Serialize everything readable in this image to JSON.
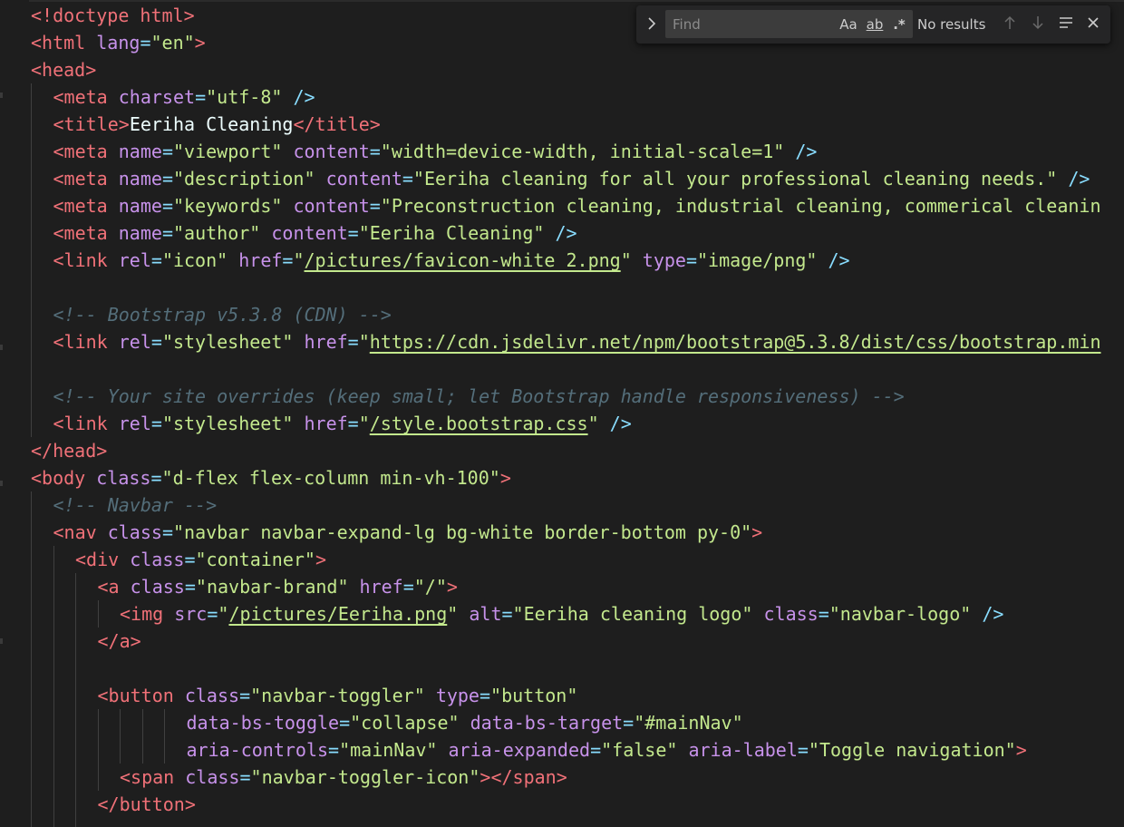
{
  "find_widget": {
    "placeholder": "Find",
    "toggle_icon": "chevron-right-icon",
    "match_case_label": "Aa",
    "whole_word_label": "ab",
    "regex_label": ".*",
    "status": "No results"
  },
  "code_lines": [
    {
      "indent": 0,
      "tokens": [
        {
          "t": "<!doctype html>",
          "c": "bracket"
        }
      ]
    },
    {
      "indent": 0,
      "tokens": [
        {
          "t": "<",
          "c": "bracket"
        },
        {
          "t": "html",
          "c": "tag"
        },
        {
          "t": " ",
          "c": "txt"
        },
        {
          "t": "lang",
          "c": "attr"
        },
        {
          "t": "=",
          "c": "eq"
        },
        {
          "t": "\"en\"",
          "c": "str"
        },
        {
          "t": ">",
          "c": "bracket"
        }
      ]
    },
    {
      "indent": 0,
      "tokens": [
        {
          "t": "<",
          "c": "bracket"
        },
        {
          "t": "head",
          "c": "tag"
        },
        {
          "t": ">",
          "c": "bracket"
        }
      ]
    },
    {
      "indent": 1,
      "tokens": [
        {
          "t": "<",
          "c": "bracket"
        },
        {
          "t": "meta",
          "c": "tag"
        },
        {
          "t": " ",
          "c": "txt"
        },
        {
          "t": "charset",
          "c": "attr"
        },
        {
          "t": "=",
          "c": "eq"
        },
        {
          "t": "\"utf-8\"",
          "c": "str"
        },
        {
          "t": " />",
          "c": "punct"
        }
      ]
    },
    {
      "indent": 1,
      "tokens": [
        {
          "t": "<",
          "c": "bracket"
        },
        {
          "t": "title",
          "c": "tag"
        },
        {
          "t": ">",
          "c": "bracket"
        },
        {
          "t": "Eeriha Cleaning",
          "c": "txt"
        },
        {
          "t": "</",
          "c": "bracket"
        },
        {
          "t": "title",
          "c": "tag"
        },
        {
          "t": ">",
          "c": "bracket"
        }
      ]
    },
    {
      "indent": 1,
      "tokens": [
        {
          "t": "<",
          "c": "bracket"
        },
        {
          "t": "meta",
          "c": "tag"
        },
        {
          "t": " ",
          "c": "txt"
        },
        {
          "t": "name",
          "c": "attr"
        },
        {
          "t": "=",
          "c": "eq"
        },
        {
          "t": "\"viewport\"",
          "c": "str"
        },
        {
          "t": " ",
          "c": "txt"
        },
        {
          "t": "content",
          "c": "attr"
        },
        {
          "t": "=",
          "c": "eq"
        },
        {
          "t": "\"width=device-width, initial-scale=1\"",
          "c": "str"
        },
        {
          "t": " />",
          "c": "punct"
        }
      ]
    },
    {
      "indent": 1,
      "tokens": [
        {
          "t": "<",
          "c": "bracket"
        },
        {
          "t": "meta",
          "c": "tag"
        },
        {
          "t": " ",
          "c": "txt"
        },
        {
          "t": "name",
          "c": "attr"
        },
        {
          "t": "=",
          "c": "eq"
        },
        {
          "t": "\"description\"",
          "c": "str"
        },
        {
          "t": " ",
          "c": "txt"
        },
        {
          "t": "content",
          "c": "attr"
        },
        {
          "t": "=",
          "c": "eq"
        },
        {
          "t": "\"Eeriha cleaning for all your professional cleaning needs.\"",
          "c": "str"
        },
        {
          "t": " />",
          "c": "punct"
        }
      ]
    },
    {
      "indent": 1,
      "tokens": [
        {
          "t": "<",
          "c": "bracket"
        },
        {
          "t": "meta",
          "c": "tag"
        },
        {
          "t": " ",
          "c": "txt"
        },
        {
          "t": "name",
          "c": "attr"
        },
        {
          "t": "=",
          "c": "eq"
        },
        {
          "t": "\"keywords\"",
          "c": "str"
        },
        {
          "t": " ",
          "c": "txt"
        },
        {
          "t": "content",
          "c": "attr"
        },
        {
          "t": "=",
          "c": "eq"
        },
        {
          "t": "\"Preconstruction cleaning, industrial cleaning, commerical cleanin",
          "c": "str"
        }
      ]
    },
    {
      "indent": 1,
      "tokens": [
        {
          "t": "<",
          "c": "bracket"
        },
        {
          "t": "meta",
          "c": "tag"
        },
        {
          "t": " ",
          "c": "txt"
        },
        {
          "t": "name",
          "c": "attr"
        },
        {
          "t": "=",
          "c": "eq"
        },
        {
          "t": "\"author\"",
          "c": "str"
        },
        {
          "t": " ",
          "c": "txt"
        },
        {
          "t": "content",
          "c": "attr"
        },
        {
          "t": "=",
          "c": "eq"
        },
        {
          "t": "\"Eeriha Cleaning\"",
          "c": "str"
        },
        {
          "t": " />",
          "c": "punct"
        }
      ]
    },
    {
      "indent": 1,
      "tokens": [
        {
          "t": "<",
          "c": "bracket"
        },
        {
          "t": "link",
          "c": "tag"
        },
        {
          "t": " ",
          "c": "txt"
        },
        {
          "t": "rel",
          "c": "attr"
        },
        {
          "t": "=",
          "c": "eq"
        },
        {
          "t": "\"icon\"",
          "c": "str"
        },
        {
          "t": " ",
          "c": "txt"
        },
        {
          "t": "href",
          "c": "attr"
        },
        {
          "t": "=",
          "c": "eq"
        },
        {
          "t": "\"",
          "c": "str"
        },
        {
          "t": "/pictures/favicon-white_2.png",
          "c": "strlink"
        },
        {
          "t": "\"",
          "c": "str"
        },
        {
          "t": " ",
          "c": "txt"
        },
        {
          "t": "type",
          "c": "attr"
        },
        {
          "t": "=",
          "c": "eq"
        },
        {
          "t": "\"image/png\"",
          "c": "str"
        },
        {
          "t": " />",
          "c": "punct"
        }
      ]
    },
    {
      "indent": 1,
      "tokens": []
    },
    {
      "indent": 1,
      "tokens": [
        {
          "t": "<!-- Bootstrap v5.3.8 (CDN) -->",
          "c": "comment"
        }
      ]
    },
    {
      "indent": 1,
      "tokens": [
        {
          "t": "<",
          "c": "bracket"
        },
        {
          "t": "link",
          "c": "tag"
        },
        {
          "t": " ",
          "c": "txt"
        },
        {
          "t": "rel",
          "c": "attr"
        },
        {
          "t": "=",
          "c": "eq"
        },
        {
          "t": "\"stylesheet\"",
          "c": "str"
        },
        {
          "t": " ",
          "c": "txt"
        },
        {
          "t": "href",
          "c": "attr"
        },
        {
          "t": "=",
          "c": "eq"
        },
        {
          "t": "\"",
          "c": "str"
        },
        {
          "t": "https://cdn.jsdelivr.net/npm/bootstrap@5.3.8/dist/css/bootstrap.min",
          "c": "strlink"
        }
      ]
    },
    {
      "indent": 1,
      "tokens": []
    },
    {
      "indent": 1,
      "tokens": [
        {
          "t": "<!-- Your site overrides (keep small; let Bootstrap handle responsiveness) -->",
          "c": "comment"
        }
      ]
    },
    {
      "indent": 1,
      "tokens": [
        {
          "t": "<",
          "c": "bracket"
        },
        {
          "t": "link",
          "c": "tag"
        },
        {
          "t": " ",
          "c": "txt"
        },
        {
          "t": "rel",
          "c": "attr"
        },
        {
          "t": "=",
          "c": "eq"
        },
        {
          "t": "\"stylesheet\"",
          "c": "str"
        },
        {
          "t": " ",
          "c": "txt"
        },
        {
          "t": "href",
          "c": "attr"
        },
        {
          "t": "=",
          "c": "eq"
        },
        {
          "t": "\"",
          "c": "str"
        },
        {
          "t": "/style.bootstrap.css",
          "c": "strlink"
        },
        {
          "t": "\"",
          "c": "str"
        },
        {
          "t": " />",
          "c": "punct"
        }
      ]
    },
    {
      "indent": 0,
      "tokens": [
        {
          "t": "</",
          "c": "bracket"
        },
        {
          "t": "head",
          "c": "tag"
        },
        {
          "t": ">",
          "c": "bracket"
        }
      ]
    },
    {
      "indent": 0,
      "tokens": [
        {
          "t": "<",
          "c": "bracket"
        },
        {
          "t": "body",
          "c": "tag"
        },
        {
          "t": " ",
          "c": "txt"
        },
        {
          "t": "class",
          "c": "attr"
        },
        {
          "t": "=",
          "c": "eq"
        },
        {
          "t": "\"d-flex flex-column min-vh-100\"",
          "c": "str"
        },
        {
          "t": ">",
          "c": "bracket"
        }
      ]
    },
    {
      "indent": 1,
      "tokens": [
        {
          "t": "<!-- Navbar -->",
          "c": "comment"
        }
      ]
    },
    {
      "indent": 1,
      "tokens": [
        {
          "t": "<",
          "c": "bracket"
        },
        {
          "t": "nav",
          "c": "tag"
        },
        {
          "t": " ",
          "c": "txt"
        },
        {
          "t": "class",
          "c": "attr"
        },
        {
          "t": "=",
          "c": "eq"
        },
        {
          "t": "\"navbar navbar-expand-lg bg-white border-bottom py-0\"",
          "c": "str"
        },
        {
          "t": ">",
          "c": "bracket"
        }
      ]
    },
    {
      "indent": 2,
      "tokens": [
        {
          "t": "<",
          "c": "bracket"
        },
        {
          "t": "div",
          "c": "tag"
        },
        {
          "t": " ",
          "c": "txt"
        },
        {
          "t": "class",
          "c": "attr"
        },
        {
          "t": "=",
          "c": "eq"
        },
        {
          "t": "\"container\"",
          "c": "str"
        },
        {
          "t": ">",
          "c": "bracket"
        }
      ]
    },
    {
      "indent": 3,
      "tokens": [
        {
          "t": "<",
          "c": "bracket"
        },
        {
          "t": "a",
          "c": "tag"
        },
        {
          "t": " ",
          "c": "txt"
        },
        {
          "t": "class",
          "c": "attr"
        },
        {
          "t": "=",
          "c": "eq"
        },
        {
          "t": "\"navbar-brand\"",
          "c": "str"
        },
        {
          "t": " ",
          "c": "txt"
        },
        {
          "t": "href",
          "c": "attr"
        },
        {
          "t": "=",
          "c": "eq"
        },
        {
          "t": "\"/\"",
          "c": "str"
        },
        {
          "t": ">",
          "c": "bracket"
        }
      ]
    },
    {
      "indent": 4,
      "tokens": [
        {
          "t": "<",
          "c": "bracket"
        },
        {
          "t": "img",
          "c": "tag"
        },
        {
          "t": " ",
          "c": "txt"
        },
        {
          "t": "src",
          "c": "attr"
        },
        {
          "t": "=",
          "c": "eq"
        },
        {
          "t": "\"",
          "c": "str"
        },
        {
          "t": "/pictures/Eeriha.png",
          "c": "strlink"
        },
        {
          "t": "\"",
          "c": "str"
        },
        {
          "t": " ",
          "c": "txt"
        },
        {
          "t": "alt",
          "c": "attr"
        },
        {
          "t": "=",
          "c": "eq"
        },
        {
          "t": "\"Eeriha cleaning logo\"",
          "c": "str"
        },
        {
          "t": " ",
          "c": "txt"
        },
        {
          "t": "class",
          "c": "attr"
        },
        {
          "t": "=",
          "c": "eq"
        },
        {
          "t": "\"navbar-logo\"",
          "c": "str"
        },
        {
          "t": " />",
          "c": "punct"
        }
      ]
    },
    {
      "indent": 3,
      "tokens": [
        {
          "t": "</",
          "c": "bracket"
        },
        {
          "t": "a",
          "c": "tag"
        },
        {
          "t": ">",
          "c": "bracket"
        }
      ]
    },
    {
      "indent": 3,
      "tokens": []
    },
    {
      "indent": 3,
      "tokens": [
        {
          "t": "<",
          "c": "bracket"
        },
        {
          "t": "button",
          "c": "tag"
        },
        {
          "t": " ",
          "c": "txt"
        },
        {
          "t": "class",
          "c": "attr"
        },
        {
          "t": "=",
          "c": "eq"
        },
        {
          "t": "\"navbar-toggler\"",
          "c": "str"
        },
        {
          "t": " ",
          "c": "txt"
        },
        {
          "t": "type",
          "c": "attr"
        },
        {
          "t": "=",
          "c": "eq"
        },
        {
          "t": "\"button\"",
          "c": "str"
        }
      ]
    },
    {
      "indent": 7,
      "tokens": [
        {
          "t": "data-bs-toggle",
          "c": "attr"
        },
        {
          "t": "=",
          "c": "eq"
        },
        {
          "t": "\"collapse\"",
          "c": "str"
        },
        {
          "t": " ",
          "c": "txt"
        },
        {
          "t": "data-bs-target",
          "c": "attr"
        },
        {
          "t": "=",
          "c": "eq"
        },
        {
          "t": "\"#mainNav\"",
          "c": "str"
        }
      ]
    },
    {
      "indent": 7,
      "tokens": [
        {
          "t": "aria-controls",
          "c": "attr"
        },
        {
          "t": "=",
          "c": "eq"
        },
        {
          "t": "\"mainNav\"",
          "c": "str"
        },
        {
          "t": " ",
          "c": "txt"
        },
        {
          "t": "aria-expanded",
          "c": "attr"
        },
        {
          "t": "=",
          "c": "eq"
        },
        {
          "t": "\"false\"",
          "c": "str"
        },
        {
          "t": " ",
          "c": "txt"
        },
        {
          "t": "aria-label",
          "c": "attr"
        },
        {
          "t": "=",
          "c": "eq"
        },
        {
          "t": "\"Toggle navigation\"",
          "c": "str"
        },
        {
          "t": ">",
          "c": "bracket"
        }
      ]
    },
    {
      "indent": 4,
      "tokens": [
        {
          "t": "<",
          "c": "bracket"
        },
        {
          "t": "span",
          "c": "tag"
        },
        {
          "t": " ",
          "c": "txt"
        },
        {
          "t": "class",
          "c": "attr"
        },
        {
          "t": "=",
          "c": "eq"
        },
        {
          "t": "\"navbar-toggler-icon\"",
          "c": "str"
        },
        {
          "t": "></",
          "c": "bracket"
        },
        {
          "t": "span",
          "c": "tag"
        },
        {
          "t": ">",
          "c": "bracket"
        }
      ]
    },
    {
      "indent": 3,
      "tokens": [
        {
          "t": "</",
          "c": "bracket"
        },
        {
          "t": "button",
          "c": "tag"
        },
        {
          "t": ">",
          "c": "bracket"
        }
      ]
    },
    {
      "indent": 3,
      "tokens": []
    }
  ]
}
